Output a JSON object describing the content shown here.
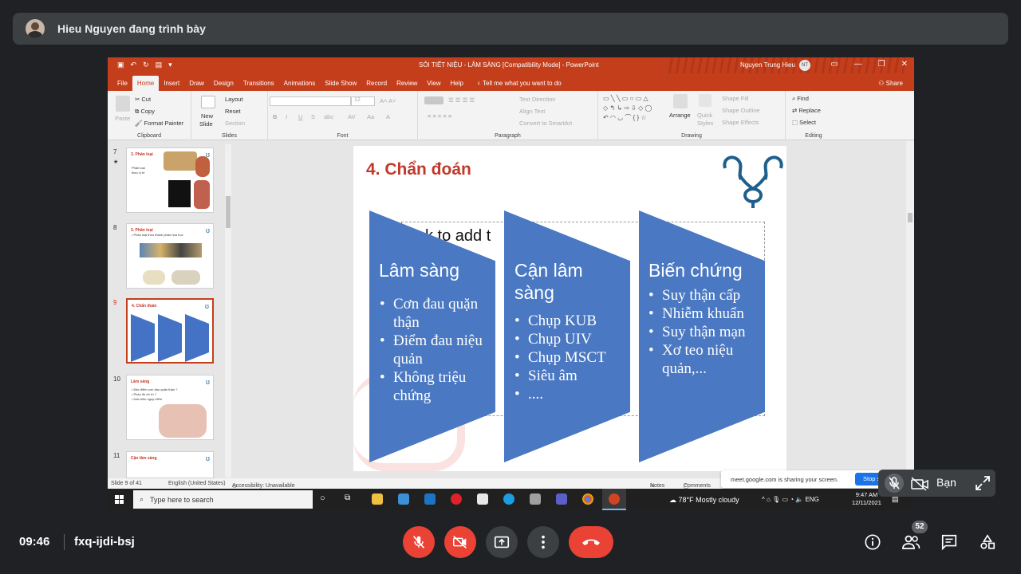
{
  "meet": {
    "presenter_banner": "Hieu Nguyen đang trình bày",
    "time": "09:46",
    "meeting_code": "fxq-ijdi-bsj",
    "participants_count": "52",
    "self_label": "Bạn",
    "share_notice": "meet.google.com is sharing your screen.",
    "stop_sharing": "Stop s"
  },
  "ppt": {
    "document_title": "SỎI TIẾT NIỆU - LÂM SÀNG [Compatibility Mode]  -  PowerPoint",
    "user_name": "Nguyen Trung Hieu",
    "user_initials": "NT",
    "tabs": [
      "File",
      "Home",
      "Insert",
      "Draw",
      "Design",
      "Transitions",
      "Animations",
      "Slide Show",
      "Record",
      "Review",
      "View",
      "Help"
    ],
    "tell_me": "Tell me what you want to do",
    "share": "Share",
    "ribbon": {
      "paste": "Paste",
      "cut": "Cut",
      "copy": "Copy",
      "format_painter": "Format Painter",
      "clipboard": "Clipboard",
      "new_slide": "New",
      "new_slide_2": "Slide",
      "layout": "Layout",
      "reset": "Reset",
      "section": "Section",
      "slides": "Slides",
      "font_size": "12",
      "font": "Font",
      "text_direction": "Text Direction",
      "align_text": "Align Text",
      "convert_smartart": "Convert to SmartArt",
      "paragraph": "Paragraph",
      "arrange": "Arrange",
      "quick_styles": "Quick",
      "quick_styles_2": "Styles",
      "shape_fill": "Shape Fill",
      "shape_outline": "Shape Outline",
      "shape_effects": "Shape Effects",
      "drawing": "Drawing",
      "find": "Find",
      "replace": "Replace",
      "select": "Select",
      "editing": "Editing"
    },
    "thumbnails": [
      {
        "num": "7",
        "title": "3. Phân loại",
        "body": "Phân loại\ntheo vị trí"
      },
      {
        "num": "8",
        "title": "3. Phân loại",
        "body": "• Phân loại theo thành phần hoá học"
      },
      {
        "num": "9",
        "title": "4. Chẩn đoán",
        "body": ""
      },
      {
        "num": "10",
        "title": "Lâm sàng",
        "body": "• Đặc điểm cơn đau quặn thận ?\n• Phác đồ xử trí ?\n• Dấu hiệu nguy hiểm"
      },
      {
        "num": "11",
        "title": "Cận lâm sàng",
        "body": ""
      }
    ],
    "thumb_star": "★",
    "slide": {
      "title": "4. Chẩn đoán",
      "placeholder": "k to add t",
      "columns": [
        {
          "heading": "Lâm sàng",
          "items": [
            "Cơn đau quặn thận",
            "Điểm đau niệu quản",
            "Không triệu chứng"
          ]
        },
        {
          "heading": "Cận lâm sàng",
          "items": [
            "Chụp KUB",
            "Chụp UIV",
            "Chụp MSCT",
            "Siêu âm",
            "...."
          ]
        },
        {
          "heading": "Biến chứng",
          "items": [
            "Suy thận cấp",
            "Nhiễm khuẩn",
            "Suy thận mạn",
            "Xơ teo  niệu quản,..."
          ]
        }
      ]
    },
    "status": {
      "slide_of": "Slide 9 of 41",
      "language": "English (United States)",
      "accessibility": "Accessibility: Unavailable",
      "notes": "Notes",
      "comments": "Comments"
    }
  },
  "taskbar": {
    "search_placeholder": "Type here to search",
    "weather": "78°F  Mostly cloudy",
    "lang": "ENG",
    "clock_time": "9:47 AM",
    "clock_date": "12/11/2021"
  },
  "colors": {
    "ppt_accent": "#c43e1c",
    "slide_title": "#c0392b",
    "column_fill": "#4a78c2",
    "meet_red": "#ea4335",
    "meet_bg": "#202124"
  }
}
